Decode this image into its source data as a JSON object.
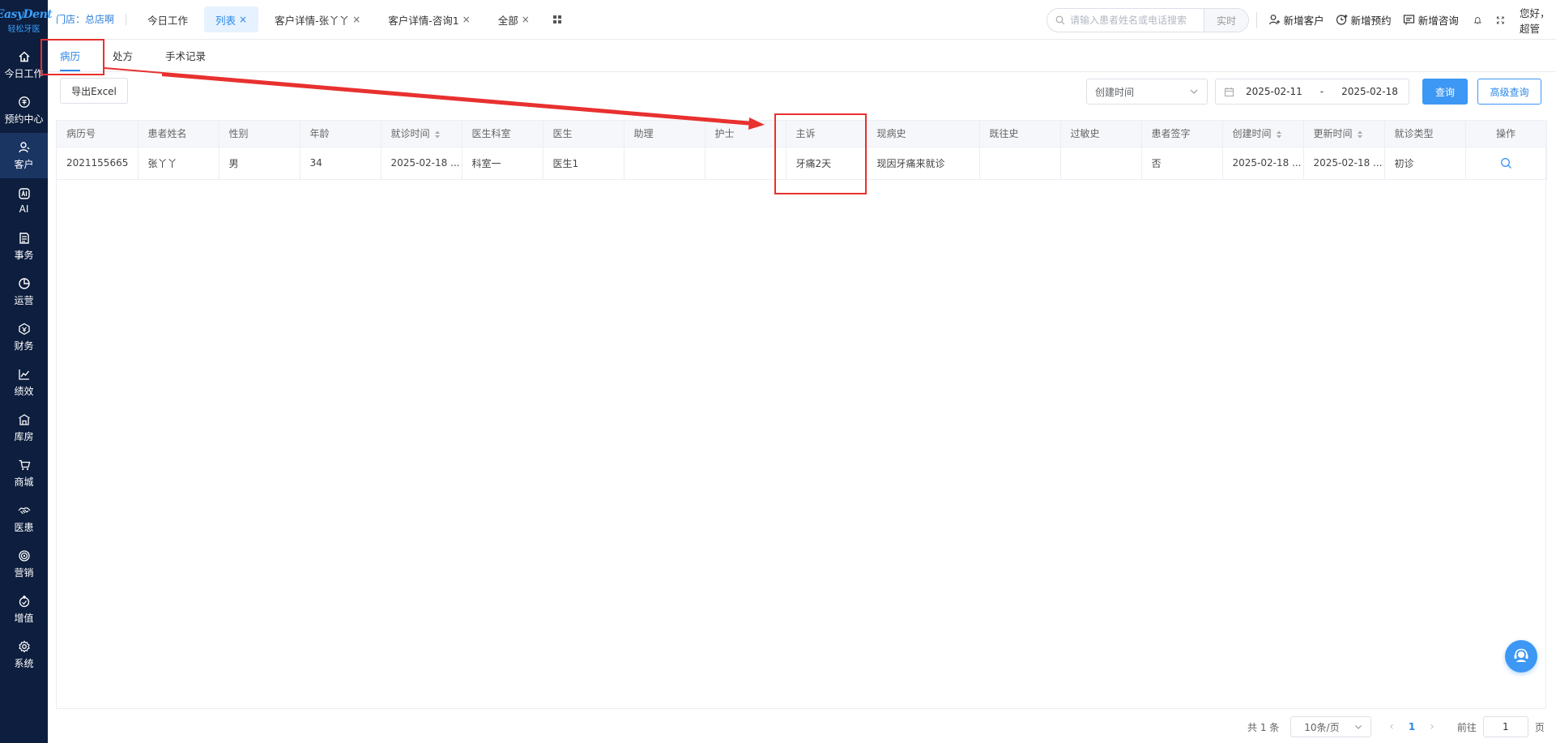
{
  "logo": {
    "main": "EasyDent",
    "sub": "轻松牙医"
  },
  "sidebar": {
    "items": [
      {
        "label": "今日工作",
        "icon": "home-icon"
      },
      {
        "label": "预约中心",
        "icon": "calendar-circle-icon"
      },
      {
        "label": "客户",
        "icon": "user-icon",
        "active": true
      },
      {
        "label": "AI",
        "icon": "ai-icon"
      },
      {
        "label": "事务",
        "icon": "document-icon"
      },
      {
        "label": "运营",
        "icon": "pie-icon"
      },
      {
        "label": "财务",
        "icon": "finance-icon"
      },
      {
        "label": "绩效",
        "icon": "line-chart-icon"
      },
      {
        "label": "库房",
        "icon": "warehouse-icon"
      },
      {
        "label": "商城",
        "icon": "cart-icon"
      },
      {
        "label": "医患",
        "icon": "handshake-icon"
      },
      {
        "label": "营销",
        "icon": "target-icon"
      },
      {
        "label": "增值",
        "icon": "growth-icon"
      },
      {
        "label": "系统",
        "icon": "gear-icon"
      }
    ]
  },
  "header": {
    "store": "门店：总店啊",
    "tabs": [
      {
        "label": "今日工作",
        "closable": false
      },
      {
        "label": "列表",
        "closable": true,
        "active": true
      },
      {
        "label": "客户详情-张丫丫",
        "closable": true
      },
      {
        "label": "客户详情-咨询1",
        "closable": true
      },
      {
        "label": "全部",
        "closable": true
      }
    ],
    "close_glyph": "×",
    "search": {
      "placeholder": "请输入患者姓名或电话搜索",
      "mode": "实时"
    },
    "actions": {
      "new_customer": "新增客户",
      "new_appointment": "新增预约",
      "new_consult": "新增咨询"
    },
    "greeting": "您好，超管"
  },
  "subtabs": [
    {
      "label": "病历",
      "active": true
    },
    {
      "label": "处方"
    },
    {
      "label": "手术记录"
    }
  ],
  "toolbar": {
    "export_label": "导出Excel",
    "time_select": "创建时间",
    "date_start": "2025-02-11",
    "date_sep": "-",
    "date_end": "2025-02-18",
    "query_label": "查询",
    "advanced_label": "高级查询"
  },
  "table": {
    "columns": [
      "病历号",
      "患者姓名",
      "性别",
      "年龄",
      "就诊时间",
      "医生科室",
      "医生",
      "助理",
      "护士",
      "主诉",
      "现病史",
      "既往史",
      "过敏史",
      "患者签字",
      "创建时间",
      "更新时间",
      "就诊类型",
      "操作"
    ],
    "rows": [
      [
        "2021155665",
        "张丫丫",
        "男",
        "34",
        "2025-02-18 ...",
        "科室一",
        "医生1",
        "",
        "",
        "牙痛2天",
        "现因牙痛来就诊",
        "",
        "",
        "否",
        "2025-02-18 ...",
        "2025-02-18 ...",
        "初诊",
        ""
      ]
    ]
  },
  "pagination": {
    "total": "共 1 条",
    "page_size": "10条/页",
    "prev": "‹",
    "current": "1",
    "next": "›",
    "goto_label": "前往",
    "goto_value": "1",
    "page_suffix": "页"
  },
  "colors": {
    "primary": "#3d97f4",
    "sidebar": "#0d1e3e",
    "annotation": "#e8312f"
  }
}
